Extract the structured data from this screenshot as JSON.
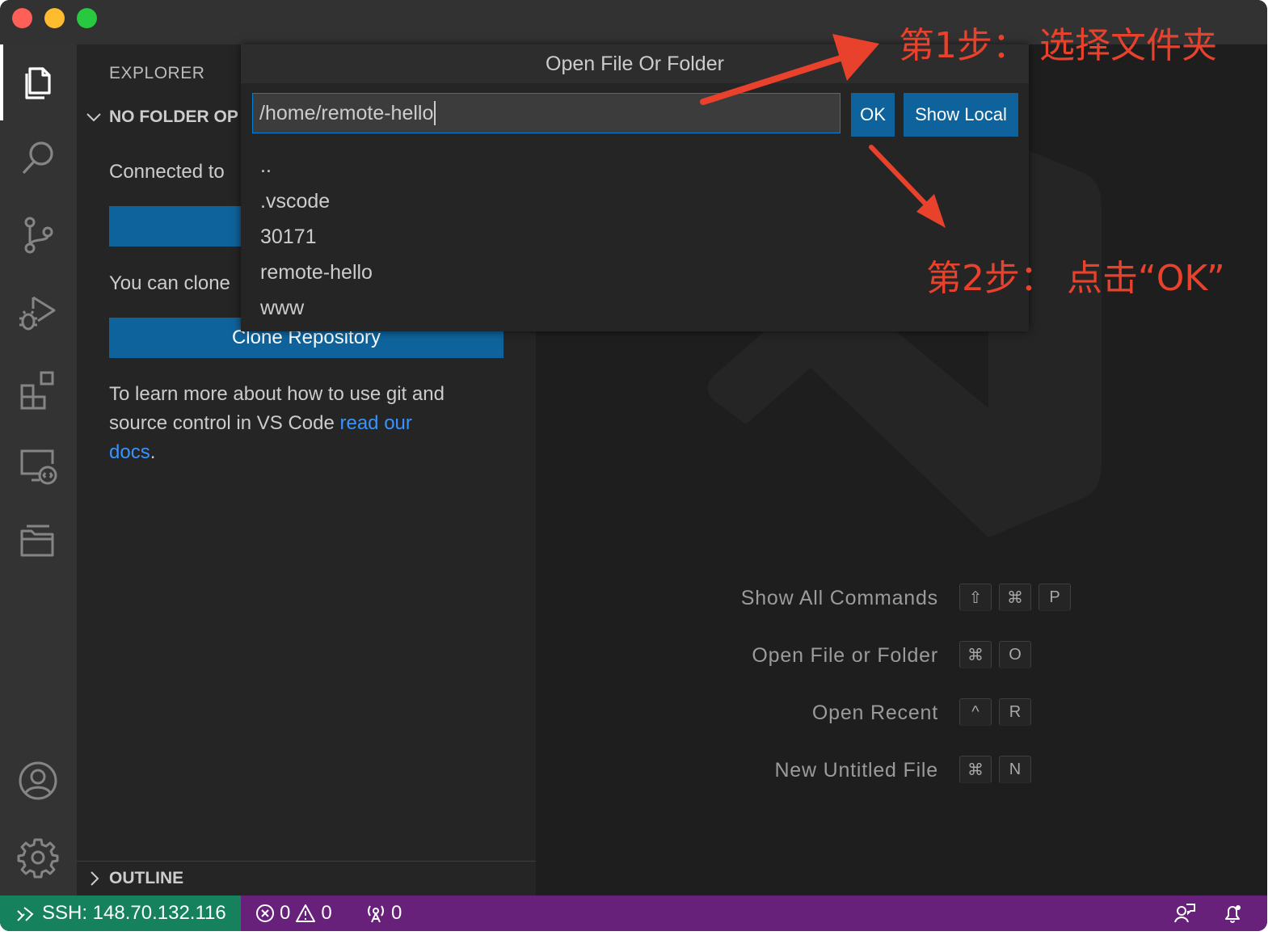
{
  "titlebar": {
    "controls": [
      "close",
      "minimize",
      "maximize"
    ]
  },
  "activity_bar": {
    "icons": [
      "files-icon",
      "search-icon",
      "source-control-icon",
      "run-debug-icon",
      "extensions-icon",
      "remote-explorer-icon",
      "folder-icon"
    ],
    "bottom_icons": [
      "account-icon",
      "gear-icon"
    ]
  },
  "sidebar": {
    "title": "EXPLORER",
    "section": "NO FOLDER OP",
    "connected_text": "Connected to",
    "clone_text": "You can clone",
    "clone_button": "Clone Repository",
    "learn_text_1": "To learn more about how to use git and",
    "learn_text_2": "source control in VS Code ",
    "learn_link_1": "read our",
    "learn_link_2": "docs",
    "learn_period": ".",
    "outline": "OUTLINE"
  },
  "quick_open": {
    "title": "Open File Or Folder",
    "input_value": "/home/remote-hello",
    "ok_button": "OK",
    "show_local_button": "Show Local",
    "items": [
      "..",
      ".vscode",
      "30171",
      "remote-hello",
      "www"
    ]
  },
  "editor": {
    "shortcuts": [
      {
        "label": "Show All Commands",
        "keys": [
          "⇧",
          "⌘",
          "P"
        ]
      },
      {
        "label": "Open File or Folder",
        "keys": [
          "⌘",
          "O"
        ]
      },
      {
        "label": "Open Recent",
        "keys": [
          "^",
          "R"
        ]
      },
      {
        "label": "New Untitled File",
        "keys": [
          "⌘",
          "N"
        ]
      }
    ]
  },
  "statusbar": {
    "remote": "SSH: 148.70.132.116",
    "errors": "0",
    "warnings": "0",
    "ports": "0",
    "colors": {
      "background": "#68217a",
      "remote": "#16825d"
    }
  },
  "annotations": {
    "step1": "第1步：  选择文件夹",
    "step2": "第2步：  点击“OK”",
    "color": "#e8412c"
  }
}
